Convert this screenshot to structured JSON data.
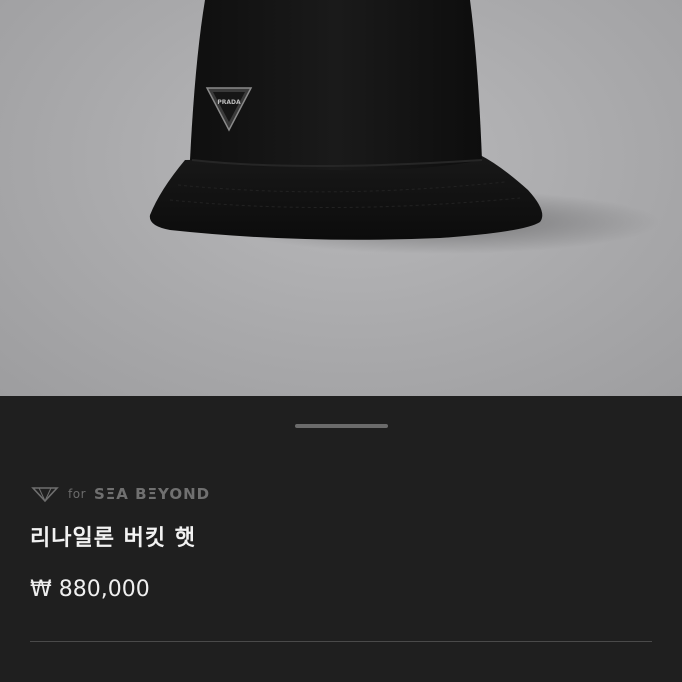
{
  "product": {
    "brand_prefix": "for",
    "brand_name": "SΞA BΞYOND",
    "title": "리나일론 버킷 햇",
    "price": "₩ 880,000",
    "logo_text": "PRADA"
  },
  "colors": {
    "sheet_bg": "#1f1f1f",
    "hero_bg": "#ababad",
    "text_primary": "#f2f2f2",
    "text_muted": "#707070"
  }
}
